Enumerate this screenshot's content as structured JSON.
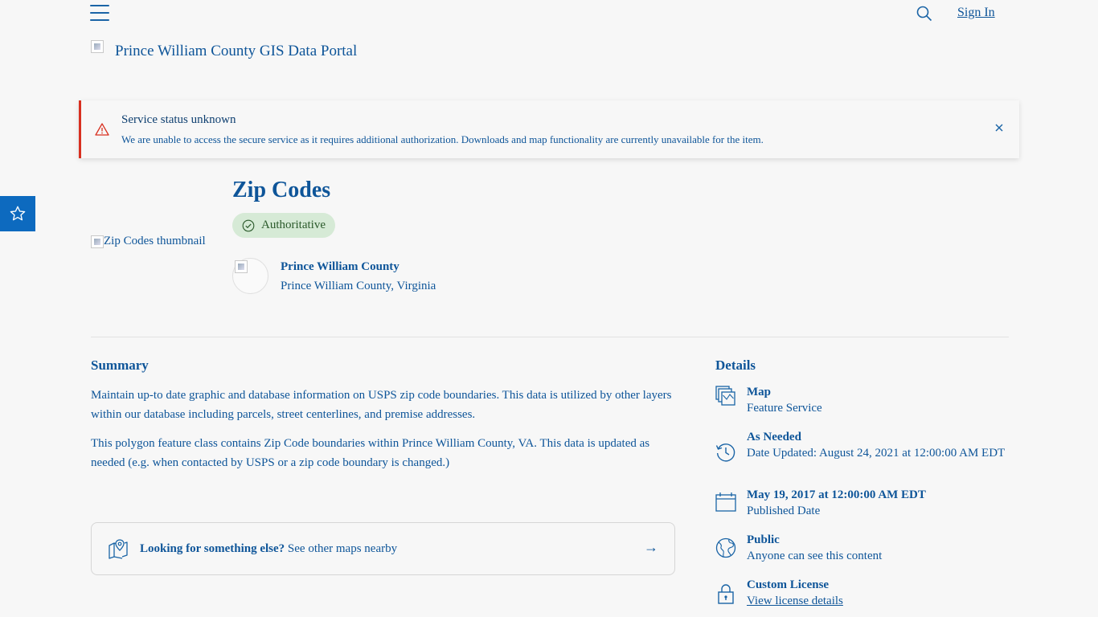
{
  "header": {
    "sign_in": "Sign In",
    "logo_text": "Prince William County GIS Data Portal"
  },
  "alert": {
    "title": "Service status unknown",
    "message": "We are unable to access the secure service as it requires additional authorization. Downloads and map functionality are currently unavailable for the item.",
    "close": "×"
  },
  "item": {
    "thumbnail_alt": "Zip Codes thumbnail",
    "title": "Zip Codes",
    "badge": "Authoritative",
    "owner_name": "Prince William County",
    "owner_location": "Prince William County, Virginia"
  },
  "summary": {
    "heading": "Summary",
    "paragraphs": [
      "Maintain up-to date graphic and database information on USPS zip code boundaries. This data is utilized by other layers within our database including parcels, street centerlines, and premise addresses.",
      "This polygon feature class contains Zip Code boundaries within Prince William County, VA. This data is updated as needed (e.g. when contacted by USPS or a zip code boundary is changed.)"
    ]
  },
  "nearby": {
    "bold": "Looking for something else?",
    "text": " See other maps nearby",
    "arrow": "→"
  },
  "details": {
    "heading": "Details",
    "items": [
      {
        "title": "Map",
        "sub": "Feature Service",
        "icon": "layers-icon"
      },
      {
        "title": "As Needed",
        "sub": "Date Updated: August 24, 2021 at 12:00:00 AM EDT",
        "icon": "history-icon"
      },
      {
        "title": "May 19, 2017 at 12:00:00 AM EDT",
        "sub": "Published Date",
        "icon": "calendar-icon"
      },
      {
        "title": "Public",
        "sub": "Anyone can see this content",
        "icon": "globe-icon"
      },
      {
        "title": "Custom License",
        "sub": "View license details",
        "icon": "lock-icon"
      }
    ]
  },
  "colors": {
    "text": "#0e5599",
    "accent": "#0d6abf",
    "alert": "#d83020",
    "badge_bg": "#d6ead6"
  }
}
